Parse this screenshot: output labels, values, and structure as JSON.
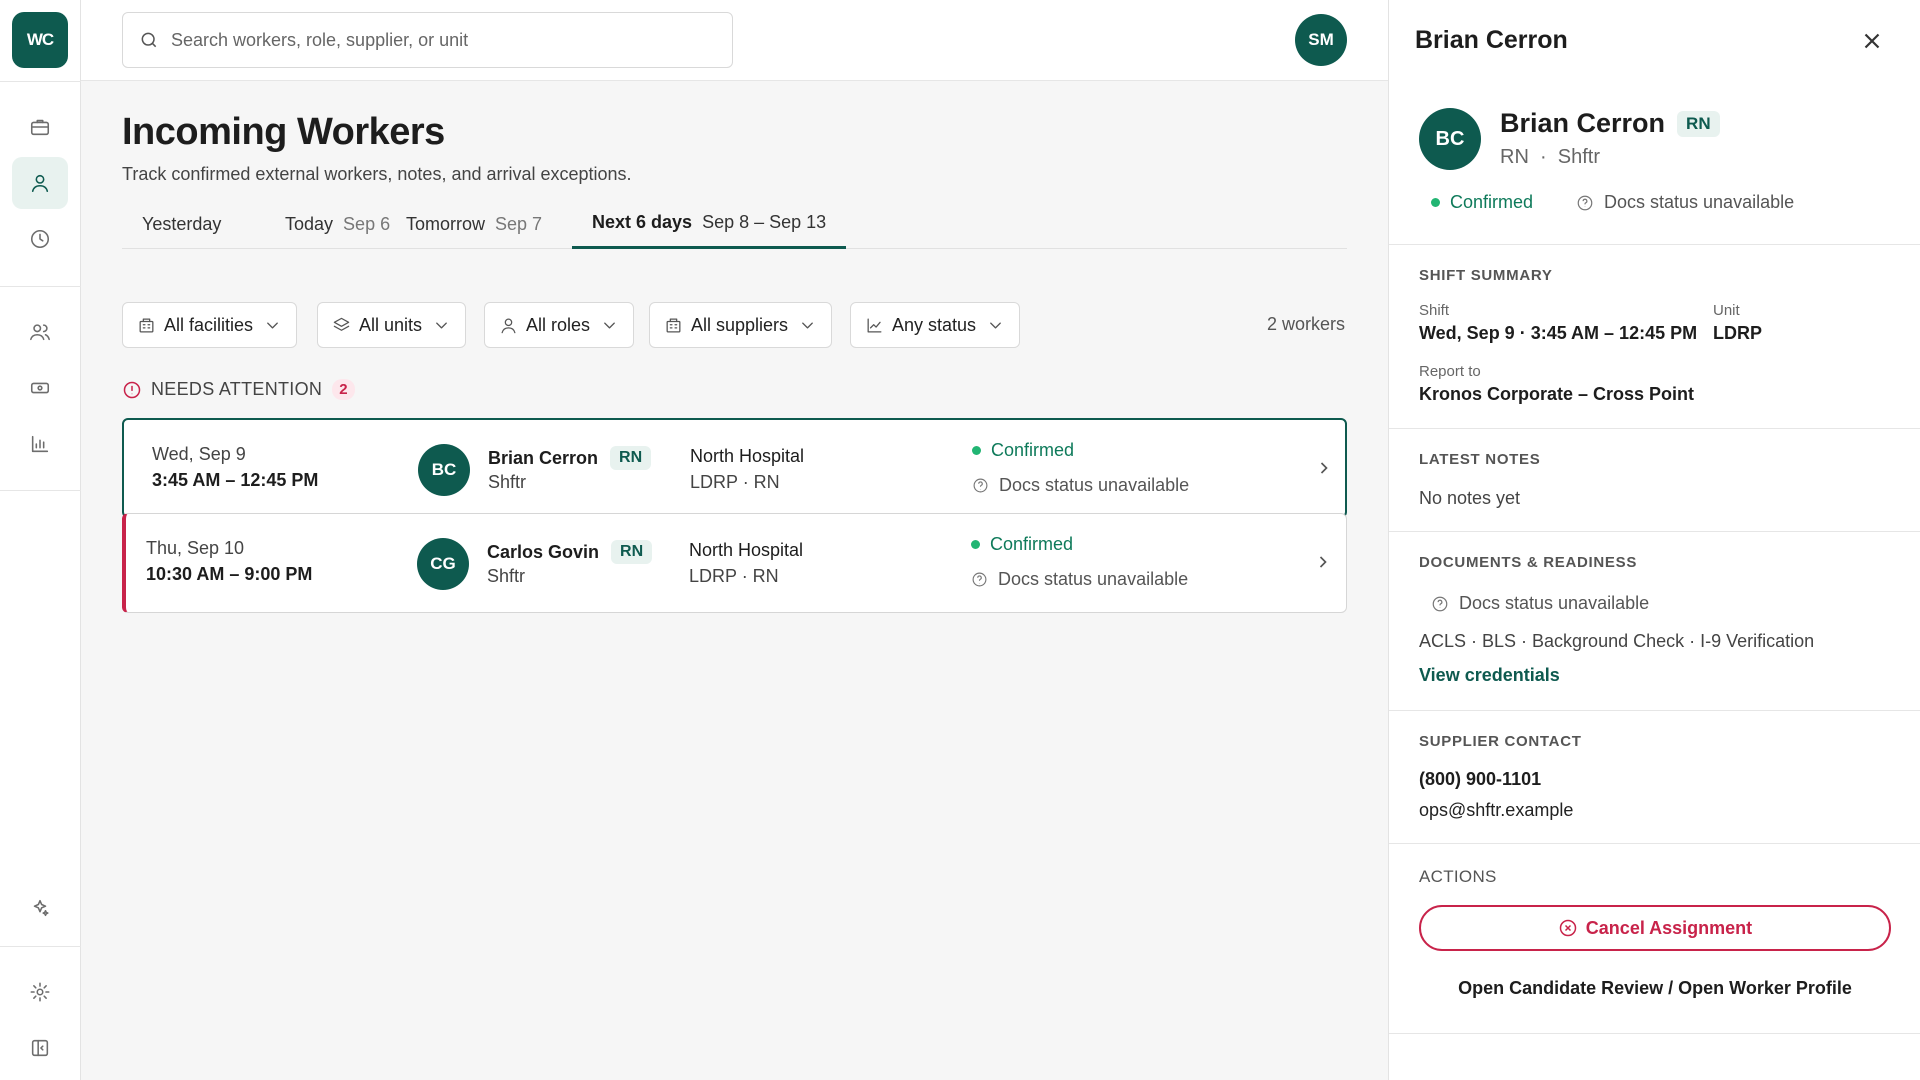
{
  "app": {
    "logo_text": "WC",
    "user_initials": "SM"
  },
  "search": {
    "placeholder": "Search workers, role, supplier, or unit"
  },
  "header": {
    "title": "Incoming Workers",
    "subtitle": "Track confirmed external workers, notes, and arrival exceptions."
  },
  "tabs": [
    {
      "label": "Yesterday",
      "date": ""
    },
    {
      "label": "Today",
      "date": "Sep 6"
    },
    {
      "label": "Tomorrow",
      "date": "Sep 7"
    },
    {
      "label": "Next 6 days",
      "date": "Sep 8 – Sep 13",
      "active": true
    }
  ],
  "filters": {
    "facilities": "All facilities",
    "units": "All units",
    "roles": "All roles",
    "suppliers": "All suppliers",
    "status": "Any status",
    "count": "2 workers"
  },
  "attention": {
    "label": "NEEDS ATTENTION",
    "count": "2"
  },
  "workers": [
    {
      "date": "Wed, Sep 9",
      "time": "3:45 AM – 12:45 PM",
      "initials": "BC",
      "name": "Brian Cerron",
      "role": "RN",
      "supplier": "Shftr",
      "facility": "North Hospital",
      "unit": "LDRP · RN",
      "status": "Confirmed",
      "docs": "Docs status unavailable"
    },
    {
      "date": "Thu, Sep 10",
      "time": "10:30 AM – 9:00 PM",
      "initials": "CG",
      "name": "Carlos Govin",
      "role": "RN",
      "supplier": "Shftr",
      "facility": "North Hospital",
      "unit": "LDRP · RN",
      "status": "Confirmed",
      "docs": "Docs status unavailable"
    }
  ],
  "panel": {
    "title": "Brian Cerron",
    "initials": "BC",
    "name": "Brian Cerron",
    "role_badge": "RN",
    "role_line": "RN  ·  Shftr",
    "status": "Confirmed",
    "docs": "Docs status unavailable",
    "shift_summary": {
      "heading": "SHIFT SUMMARY",
      "shift_label": "Shift",
      "shift_value": "Wed, Sep 9 · 3:45 AM – 12:45 PM",
      "unit_label": "Unit",
      "unit_value": "LDRP",
      "report_label": "Report to",
      "report_value": "Kronos Corporate – Cross Point"
    },
    "notes": {
      "heading": "LATEST NOTES",
      "value": "No notes yet"
    },
    "documents": {
      "heading": "DOCUMENTS & READINESS",
      "status": "Docs status unavailable",
      "list": "ACLS · BLS · Background Check · I-9 Verification",
      "link": "View credentials"
    },
    "supplier": {
      "heading": "SUPPLIER CONTACT",
      "phone": "(800) 900-1101",
      "email": "ops@shftr.example"
    },
    "actions": {
      "heading": "ACTIONS",
      "cancel": "Cancel Assignment",
      "open": "Open Candidate Review / Open Worker Profile"
    }
  },
  "colors": {
    "brand": "#0e5a4f",
    "alert": "#c8234a",
    "success": "#22b573"
  }
}
